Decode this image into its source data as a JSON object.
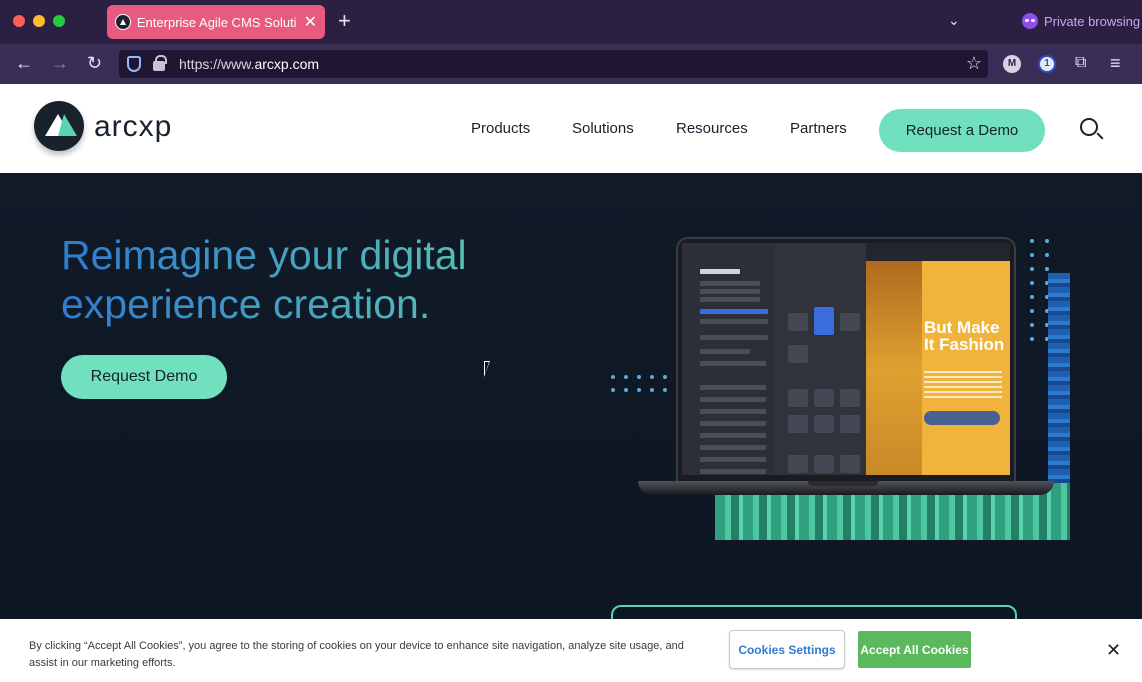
{
  "browser": {
    "tab_title": "Enterprise Agile CMS Solution |",
    "private_label": "Private browsing",
    "url_prefix": "https://www.",
    "url_domain": "arcxp.com",
    "extensions": [
      {
        "name": "m-extension-icon",
        "label": "M"
      },
      {
        "name": "one-extension-icon",
        "label": "1"
      }
    ]
  },
  "site": {
    "logo_text": "arcxp",
    "nav": [
      "Products",
      "Solutions",
      "Resources",
      "Partners"
    ],
    "cta_label": "Request a Demo"
  },
  "hero": {
    "title": "Reimagine your digital experience creation.",
    "button_label": "Request Demo",
    "ad_title": "But Make It Fashion"
  },
  "cookie": {
    "text": "By clicking “Accept All Cookies”, you agree to the storing of cookies on your device to enhance site navigation, analyze site usage, and assist in our marketing efforts.",
    "settings_label": "Cookies Settings",
    "accept_label": "Accept All Cookies",
    "close_label": "✕"
  },
  "colors": {
    "accent_mint": "#70e0bf",
    "tab_pink": "#e85a7f",
    "hero_bg": "#111b28",
    "accept_green": "#5cb85c"
  }
}
